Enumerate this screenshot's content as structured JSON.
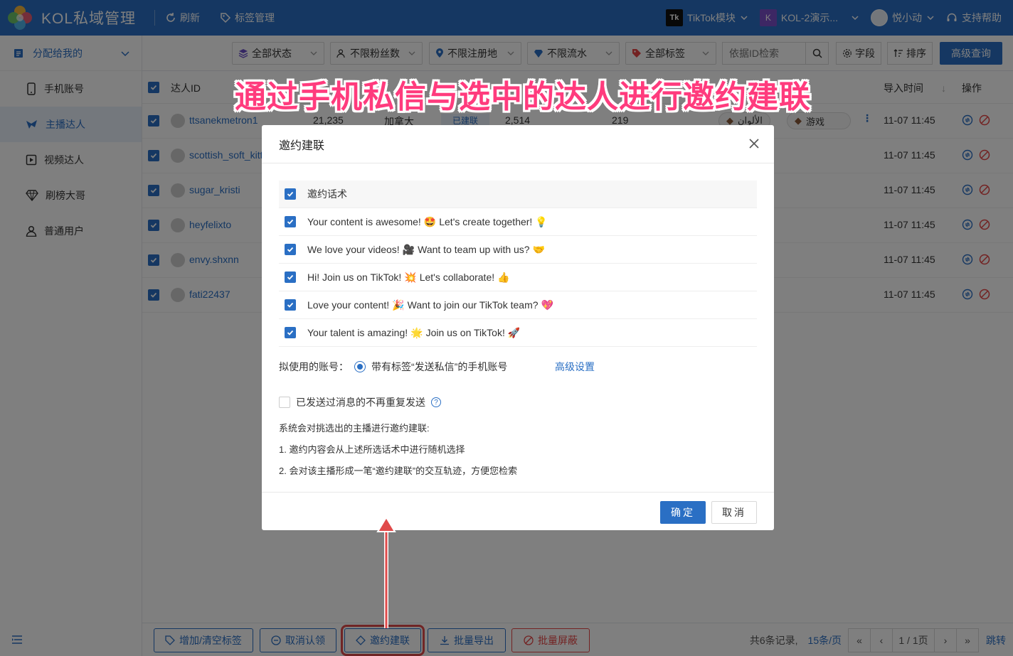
{
  "header": {
    "app_title": "KOL私域管理",
    "refresh_label": "刷新",
    "tags_label": "标签管理",
    "tiktok_logo_text": "Tk",
    "module_label": "TikTok模块",
    "account_logo_text": "K",
    "account_label": "KOL-2演示...",
    "user_label": "悦小动",
    "help_label": "支持帮助"
  },
  "sidebar": {
    "group_label": "分配给我的",
    "items": [
      {
        "label": "手机账号",
        "icon": "phone-icon"
      },
      {
        "label": "主播达人",
        "icon": "streamer-icon"
      },
      {
        "label": "视频达人",
        "icon": "video-icon"
      },
      {
        "label": "刷榜大哥",
        "icon": "diamond-icon"
      },
      {
        "label": "普通用户",
        "icon": "user-icon"
      }
    ]
  },
  "filters": {
    "status": "全部状态",
    "fans": "不限粉丝数",
    "region": "不限注册地",
    "flow": "不限流水",
    "tags": "全部标签",
    "search_placeholder": "依据ID检索",
    "fields_label": "字段",
    "sort_label": "排序",
    "advanced_label": "高级查询"
  },
  "table": {
    "col_id": "达人ID",
    "col_import_time": "导入时间",
    "col_actions": "操作",
    "rows": [
      {
        "id": "ttsanekmetron1",
        "time": "11-07 11:45",
        "fans": "21,235",
        "region": "加拿大",
        "status": "已建联",
        "v1": "2,514",
        "v2": "219",
        "tag1": "الألوان",
        "tag2": "游戏"
      },
      {
        "id": "scottish_soft_kitt",
        "time": "11-07 11:45"
      },
      {
        "id": "sugar_kristi",
        "time": "11-07 11:45"
      },
      {
        "id": "heyfelixto",
        "time": "11-07 11:45"
      },
      {
        "id": "envy.shxnn",
        "time": "11-07 11:45"
      },
      {
        "id": "fati22437",
        "time": "11-07 11:45"
      }
    ]
  },
  "bottom": {
    "btn_tags": "增加/清空标签",
    "btn_unclaim": "取消认领",
    "btn_invite": "邀约建联",
    "btn_export": "批量导出",
    "btn_block": "批量屏蔽",
    "total": "共6条记录,",
    "page_size": "15条/页",
    "page": "1 / 1页",
    "jump": "跳转"
  },
  "banner": "通过手机私信与选中的达人进行邀约建联",
  "modal": {
    "title": "邀约建联",
    "header_label": "邀约话术",
    "scripts": [
      {
        "text1": "Your content is awesome!",
        "emoji1": "🤩",
        "text2": "Let's create together!",
        "emoji2": "💡"
      },
      {
        "text1": "We love your videos!",
        "emoji1": "🎥",
        "text2": "Want to team up with us?",
        "emoji2": "🤝"
      },
      {
        "text1": "Hi! Join us on TikTok!",
        "emoji1": "💥",
        "text2": "Let's collaborate!",
        "emoji2": "👍"
      },
      {
        "text1": "Love your content!",
        "emoji1": "🎉",
        "text2": "Want to join our TikTok team?",
        "emoji2": "💖"
      },
      {
        "text1": "Your talent is amazing!",
        "emoji1": "🌟",
        "text2": "Join us on TikTok!",
        "emoji2": "🚀"
      }
    ],
    "account_label": "拟使用的账号：",
    "account_option": "带有标签“发送私信”的手机账号",
    "advanced_settings": "高级设置",
    "no_repeat_label": "已发送过消息的不再重复发送",
    "note_title": "系统会对挑选出的主播进行邀约建联:",
    "note_1": "1. 邀约内容会从上述所选话术中进行随机选择",
    "note_2": "2. 会对该主播形成一笔“邀约建联”的交互轨迹，方便您检索",
    "ok_label": "确定",
    "cancel_label": "取消"
  },
  "colors": {
    "primary": "#2a6fc4",
    "danger": "#e64545",
    "banner": "#ff3b7d"
  }
}
